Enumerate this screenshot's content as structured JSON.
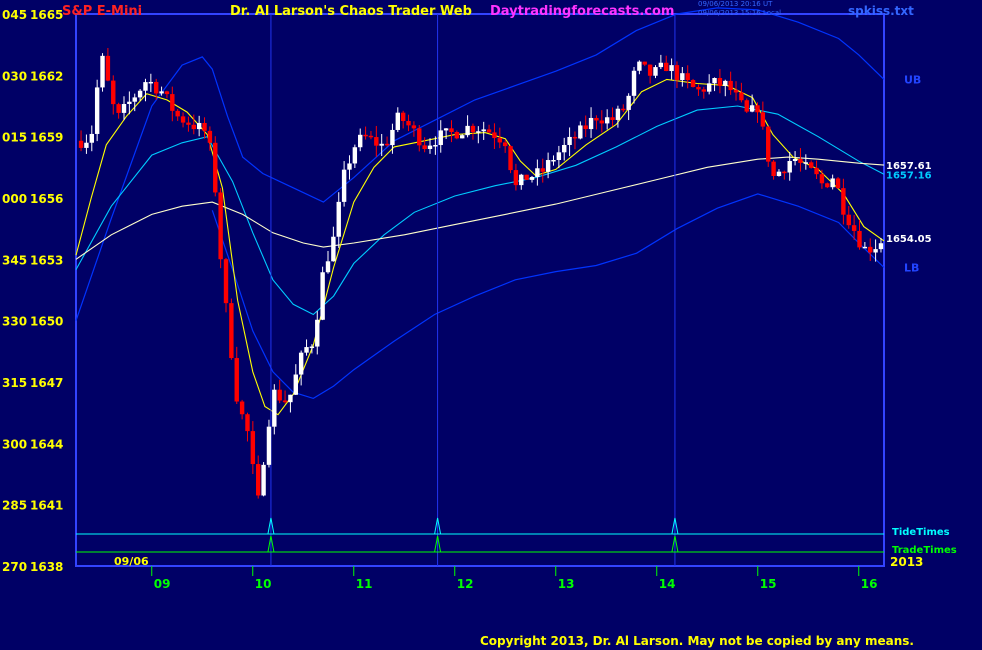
{
  "header": {
    "symbol": "S&P E-Mini",
    "title": "Dr. Al Larson's Chaos Trader Web",
    "site": "Daytradingforecasts.com",
    "timestamp_ut": "09/06/2013 20:16 UT",
    "timestamp_local": "09/06/2013 15:16 Local",
    "filename": "spkiss.txt"
  },
  "footer": {
    "copyright": "Copyright 2013, Dr. Al Larson. May not be copied by any means."
  },
  "colors": {
    "background": "#000066",
    "price_up": "#ffffff",
    "price_down": "#ff0000",
    "ema_fast": "#ffff00",
    "mid_band": "#00ccff",
    "slow_avg": "#ffffcc",
    "outer_band": "#0033ff",
    "tide_times": "#00ffff",
    "trade_times": "#00ff00"
  },
  "chart_data": {
    "type": "candlestick",
    "title": "S&P E-Mini",
    "date_label": "09/06",
    "year_label": "2013",
    "ylim": [
      1638,
      1665
    ],
    "y_ticks": [
      {
        "value": 1665,
        "alt": "045",
        "label": "1665"
      },
      {
        "value": 1662,
        "alt": "030",
        "label": "1662"
      },
      {
        "value": 1659,
        "alt": "015",
        "label": "1659"
      },
      {
        "value": 1656,
        "alt": "000",
        "label": "1656"
      },
      {
        "value": 1653,
        "alt": "345",
        "label": "1653"
      },
      {
        "value": 1650,
        "alt": "330",
        "label": "1650"
      },
      {
        "value": 1647,
        "alt": "315",
        "label": "1647"
      },
      {
        "value": 1644,
        "alt": "300",
        "label": "1644"
      },
      {
        "value": 1641,
        "alt": "285",
        "label": "1641"
      },
      {
        "value": 1638,
        "alt": "270",
        "label": "1638"
      }
    ],
    "xlim": [
      8.25,
      16.25
    ],
    "x_ticks": [
      {
        "value": 9,
        "label": "09"
      },
      {
        "value": 10,
        "label": "10"
      },
      {
        "value": 11,
        "label": "11"
      },
      {
        "value": 12,
        "label": "12"
      },
      {
        "value": 13,
        "label": "13"
      },
      {
        "value": 14,
        "label": "14"
      },
      {
        "value": 15,
        "label": "15"
      },
      {
        "value": 16,
        "label": "16"
      }
    ],
    "price_path": [
      [
        8.25,
        1658.7
      ],
      [
        8.4,
        1659
      ],
      [
        8.5,
        1663
      ],
      [
        8.65,
        1659.8
      ],
      [
        8.8,
        1660.8
      ],
      [
        8.95,
        1661.8
      ],
      [
        9.1,
        1661.2
      ],
      [
        9.25,
        1660
      ],
      [
        9.4,
        1659.6
      ],
      [
        9.55,
        1659.2
      ],
      [
        9.62,
        1657
      ],
      [
        9.7,
        1652
      ],
      [
        9.8,
        1648
      ],
      [
        9.85,
        1646
      ],
      [
        9.95,
        1644.5
      ],
      [
        10.05,
        1641
      ],
      [
        10.12,
        1643.8
      ],
      [
        10.2,
        1646.5
      ],
      [
        10.35,
        1646
      ],
      [
        10.5,
        1648.5
      ],
      [
        10.6,
        1649
      ],
      [
        10.7,
        1652.5
      ],
      [
        10.8,
        1654
      ],
      [
        10.9,
        1657
      ],
      [
        11.0,
        1658.5
      ],
      [
        11.1,
        1659
      ],
      [
        11.3,
        1658.5
      ],
      [
        11.45,
        1660
      ],
      [
        11.55,
        1659.5
      ],
      [
        11.7,
        1658.6
      ],
      [
        11.85,
        1659
      ],
      [
        12.0,
        1659.2
      ],
      [
        12.15,
        1659.5
      ],
      [
        12.3,
        1659.4
      ],
      [
        12.5,
        1658.8
      ],
      [
        12.6,
        1656.5
      ],
      [
        12.7,
        1657
      ],
      [
        12.85,
        1657.2
      ],
      [
        13.0,
        1658.1
      ],
      [
        13.2,
        1659
      ],
      [
        13.4,
        1660
      ],
      [
        13.55,
        1659.8
      ],
      [
        13.7,
        1660.5
      ],
      [
        13.8,
        1662.5
      ],
      [
        13.95,
        1662
      ],
      [
        14.1,
        1662.5
      ],
      [
        14.25,
        1661.8
      ],
      [
        14.4,
        1661.2
      ],
      [
        14.55,
        1661.6
      ],
      [
        14.7,
        1661.5
      ],
      [
        14.8,
        1660.8
      ],
      [
        14.9,
        1660
      ],
      [
        15.0,
        1660.5
      ],
      [
        15.08,
        1658.5
      ],
      [
        15.15,
        1657
      ],
      [
        15.25,
        1657.5
      ],
      [
        15.35,
        1658
      ],
      [
        15.45,
        1657.5
      ],
      [
        15.55,
        1657.2
      ],
      [
        15.65,
        1656.6
      ],
      [
        15.75,
        1657.1
      ],
      [
        15.85,
        1655.5
      ],
      [
        15.95,
        1654.5
      ],
      [
        16.05,
        1653.5
      ],
      [
        16.15,
        1653.6
      ],
      [
        16.25,
        1654.05
      ]
    ],
    "series": [
      {
        "name": "UB",
        "values": [
          [
            8.25,
            1650
          ],
          [
            8.6,
            1655
          ],
          [
            9.0,
            1660.5
          ],
          [
            9.3,
            1662.5
          ],
          [
            9.5,
            1662.9
          ],
          [
            9.6,
            1662.3
          ],
          [
            9.75,
            1660
          ],
          [
            9.9,
            1658
          ],
          [
            10.1,
            1657.2
          ],
          [
            10.4,
            1656.5
          ],
          [
            10.7,
            1655.8
          ],
          [
            11.0,
            1657
          ],
          [
            11.4,
            1658.8
          ],
          [
            11.8,
            1659.8
          ],
          [
            12.2,
            1660.8
          ],
          [
            12.6,
            1661.5
          ],
          [
            13.0,
            1662.2
          ],
          [
            13.4,
            1663
          ],
          [
            13.8,
            1664.2
          ],
          [
            14.2,
            1665
          ],
          [
            14.6,
            1665.3
          ],
          [
            15.0,
            1665.2
          ],
          [
            15.4,
            1664.6
          ],
          [
            15.8,
            1663.8
          ],
          [
            16.0,
            1663
          ],
          [
            16.25,
            1661.8
          ]
        ]
      },
      {
        "name": "",
        "values": [
          [
            8.25,
            1652.5
          ],
          [
            8.6,
            1655.6
          ],
          [
            9.0,
            1658.1
          ],
          [
            9.3,
            1658.7
          ],
          [
            9.55,
            1659
          ],
          [
            9.8,
            1656.8
          ],
          [
            10.0,
            1654.3
          ],
          [
            10.2,
            1652
          ],
          [
            10.4,
            1650.8
          ],
          [
            10.6,
            1650.3
          ],
          [
            10.8,
            1651.2
          ],
          [
            11.0,
            1652.8
          ],
          [
            11.3,
            1654.2
          ],
          [
            11.6,
            1655.3
          ],
          [
            12.0,
            1656.1
          ],
          [
            12.4,
            1656.6
          ],
          [
            12.8,
            1657
          ],
          [
            13.2,
            1657.6
          ],
          [
            13.6,
            1658.5
          ],
          [
            14.0,
            1659.5
          ],
          [
            14.4,
            1660.3
          ],
          [
            14.8,
            1660.5
          ],
          [
            15.2,
            1660.1
          ],
          [
            15.6,
            1659
          ],
          [
            16.0,
            1657.8
          ],
          [
            16.25,
            1657.16
          ]
        ]
      },
      {
        "name": "",
        "values": [
          [
            8.25,
            1653
          ],
          [
            8.6,
            1654.2
          ],
          [
            9.0,
            1655.2
          ],
          [
            9.3,
            1655.6
          ],
          [
            9.6,
            1655.8
          ],
          [
            9.9,
            1655.2
          ],
          [
            10.2,
            1654.3
          ],
          [
            10.5,
            1653.8
          ],
          [
            10.7,
            1653.6
          ],
          [
            11.0,
            1653.8
          ],
          [
            11.5,
            1654.2
          ],
          [
            12.0,
            1654.7
          ],
          [
            12.5,
            1655.2
          ],
          [
            13.0,
            1655.7
          ],
          [
            13.5,
            1656.3
          ],
          [
            14.0,
            1656.9
          ],
          [
            14.5,
            1657.5
          ],
          [
            15.0,
            1657.9
          ],
          [
            15.3,
            1658
          ],
          [
            15.6,
            1657.9
          ],
          [
            16.0,
            1657.7
          ],
          [
            16.25,
            1657.61
          ]
        ]
      },
      {
        "name": "LB",
        "values": [
          [
            9.6,
            1655.4
          ],
          [
            9.8,
            1652.5
          ],
          [
            10.0,
            1649.5
          ],
          [
            10.2,
            1647.5
          ],
          [
            10.4,
            1646.5
          ],
          [
            10.6,
            1646.2
          ],
          [
            10.8,
            1646.8
          ],
          [
            11.0,
            1647.6
          ],
          [
            11.4,
            1649
          ],
          [
            11.8,
            1650.3
          ],
          [
            12.2,
            1651.2
          ],
          [
            12.6,
            1652
          ],
          [
            13.0,
            1652.4
          ],
          [
            13.4,
            1652.7
          ],
          [
            13.8,
            1653.3
          ],
          [
            14.2,
            1654.5
          ],
          [
            14.6,
            1655.5
          ],
          [
            15.0,
            1656.2
          ],
          [
            15.4,
            1655.6
          ],
          [
            15.8,
            1654.8
          ],
          [
            16.0,
            1653.8
          ],
          [
            16.25,
            1652.6
          ]
        ]
      },
      {
        "name": "",
        "values": [
          [
            8.25,
            1653.2
          ],
          [
            8.4,
            1656
          ],
          [
            8.55,
            1658.6
          ],
          [
            8.75,
            1660
          ],
          [
            8.95,
            1661.1
          ],
          [
            9.15,
            1660.8
          ],
          [
            9.35,
            1660.2
          ],
          [
            9.55,
            1659.1
          ],
          [
            9.7,
            1656.5
          ],
          [
            9.85,
            1651
          ],
          [
            10.0,
            1647.5
          ],
          [
            10.12,
            1645.8
          ],
          [
            10.25,
            1645.4
          ],
          [
            10.4,
            1646.4
          ],
          [
            10.6,
            1648.8
          ],
          [
            10.8,
            1652.6
          ],
          [
            11.0,
            1655.8
          ],
          [
            11.2,
            1657.5
          ],
          [
            11.4,
            1658.5
          ],
          [
            11.7,
            1658.8
          ],
          [
            12.0,
            1659.1
          ],
          [
            12.3,
            1659.2
          ],
          [
            12.5,
            1658.9
          ],
          [
            12.65,
            1657.8
          ],
          [
            12.8,
            1657.1
          ],
          [
            13.0,
            1657.4
          ],
          [
            13.3,
            1658.6
          ],
          [
            13.6,
            1659.6
          ],
          [
            13.85,
            1661.2
          ],
          [
            14.1,
            1661.8
          ],
          [
            14.4,
            1661.6
          ],
          [
            14.7,
            1661.5
          ],
          [
            14.95,
            1660.9
          ],
          [
            15.15,
            1659.1
          ],
          [
            15.35,
            1658
          ],
          [
            15.6,
            1657.4
          ],
          [
            15.85,
            1656.2
          ],
          [
            16.05,
            1654.6
          ],
          [
            16.25,
            1653.9
          ]
        ]
      }
    ],
    "value_labels": [
      {
        "value": 1657.61,
        "label": "1657.61"
      },
      {
        "value": 1657.16,
        "label": "1657.16"
      },
      {
        "value": 1654.05,
        "label": "1654.05"
      }
    ],
    "band_labels": [
      {
        "value": 1661.8,
        "label": "UB"
      },
      {
        "value": 1652.6,
        "label": "LB"
      }
    ],
    "tide_times": {
      "label": "TideTimes",
      "x": [
        10.18,
        11.83,
        14.18
      ]
    },
    "trade_times": {
      "label": "TradeTimes",
      "x": [
        10.18,
        11.83,
        14.18
      ]
    }
  }
}
